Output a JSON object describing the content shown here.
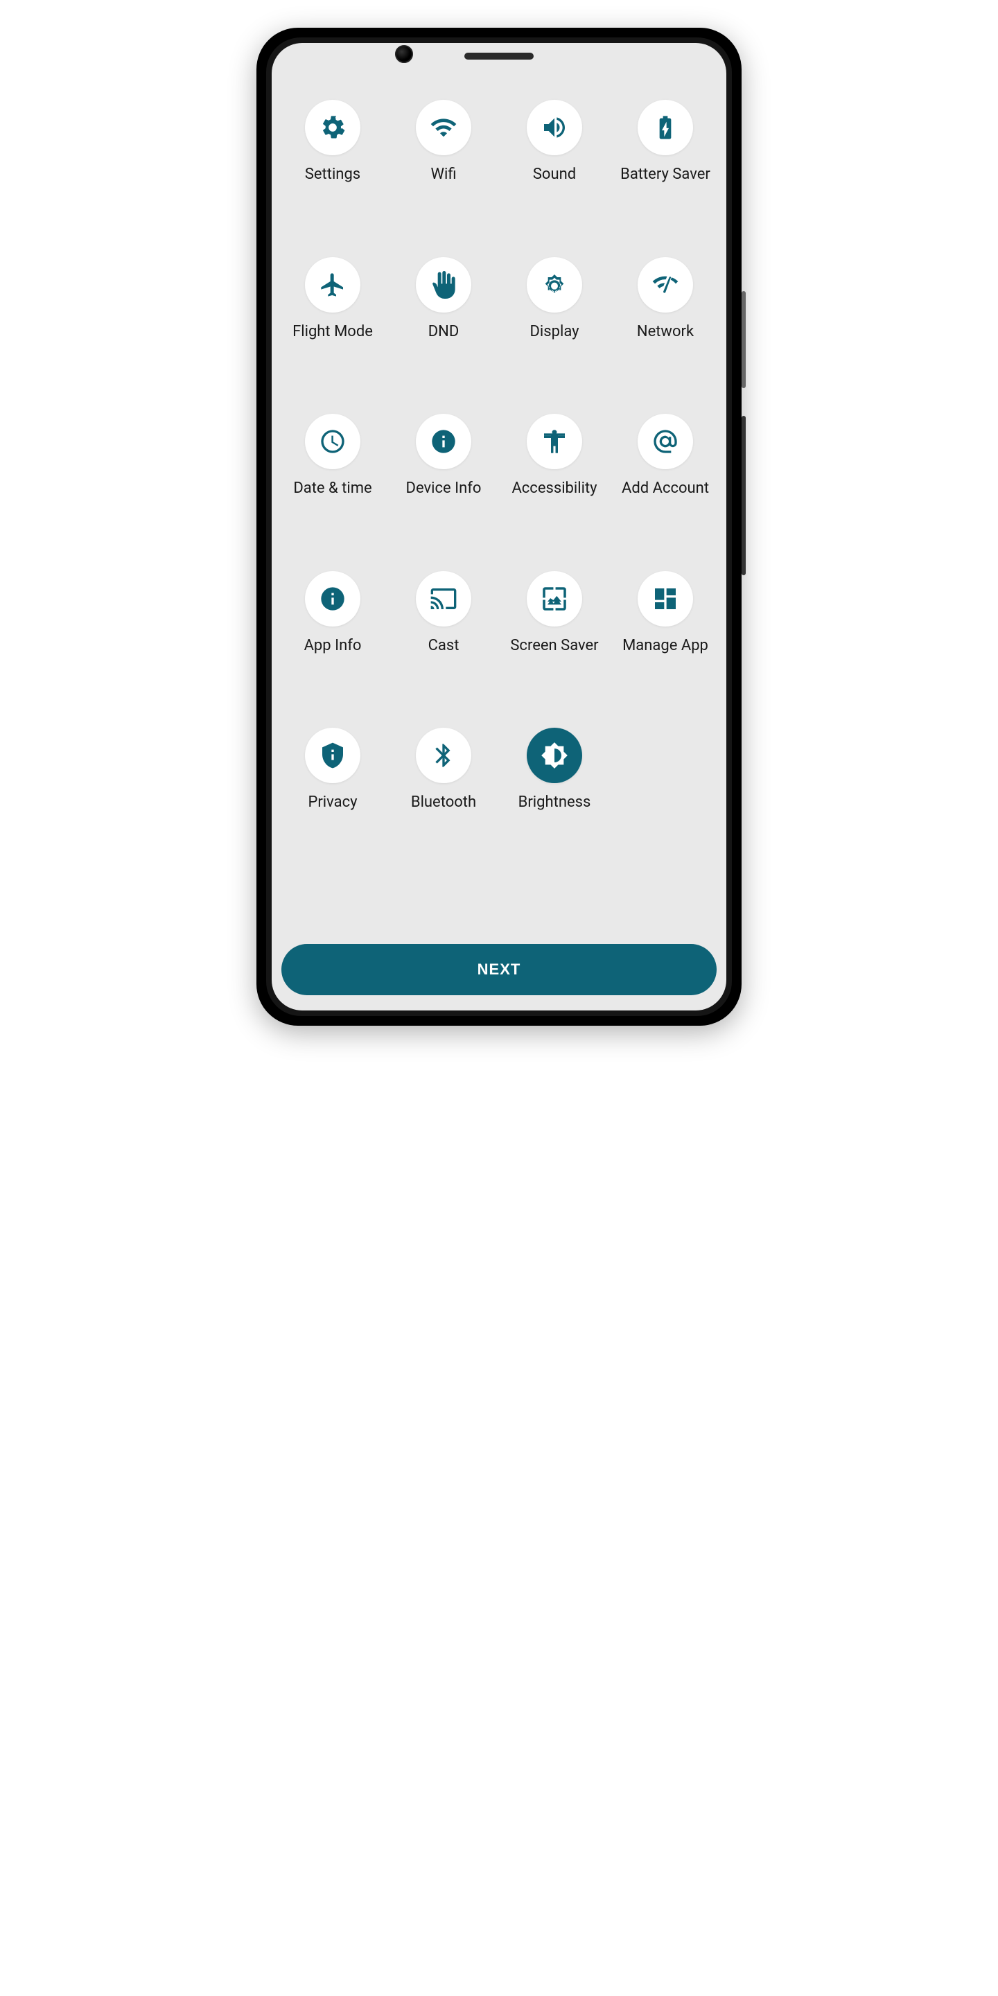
{
  "tiles": [
    {
      "id": "settings",
      "label": "Settings",
      "icon": "gear-icon",
      "active": false
    },
    {
      "id": "wifi",
      "label": "Wifi",
      "icon": "wifi-icon",
      "active": false
    },
    {
      "id": "sound",
      "label": "Sound",
      "icon": "sound-icon",
      "active": false
    },
    {
      "id": "battery-saver",
      "label": "Battery Saver",
      "icon": "battery-icon",
      "active": false
    },
    {
      "id": "flight-mode",
      "label": "Flight Mode",
      "icon": "airplane-icon",
      "active": false
    },
    {
      "id": "dnd",
      "label": "DND",
      "icon": "hand-icon",
      "active": false
    },
    {
      "id": "display",
      "label": "Display",
      "icon": "brightness-ring-icon",
      "active": false
    },
    {
      "id": "network",
      "label": "Network",
      "icon": "network-check-icon",
      "active": false
    },
    {
      "id": "date-time",
      "label": "Date & time",
      "icon": "clock-icon",
      "active": false
    },
    {
      "id": "device-info",
      "label": "Device Info",
      "icon": "info-icon",
      "active": false
    },
    {
      "id": "accessibility",
      "label": "Accessibility",
      "icon": "accessibility-icon",
      "active": false
    },
    {
      "id": "add-account",
      "label": "Add Account",
      "icon": "at-icon",
      "active": false
    },
    {
      "id": "app-info",
      "label": "App Info",
      "icon": "info-icon",
      "active": false
    },
    {
      "id": "cast",
      "label": "Cast",
      "icon": "cast-icon",
      "active": false
    },
    {
      "id": "screen-saver",
      "label": "Screen Saver",
      "icon": "wallpaper-icon",
      "active": false
    },
    {
      "id": "manage-app",
      "label": "Manage App",
      "icon": "dashboard-icon",
      "active": false
    },
    {
      "id": "privacy",
      "label": "Privacy",
      "icon": "privacy-icon",
      "active": false
    },
    {
      "id": "bluetooth",
      "label": "Bluetooth",
      "icon": "bluetooth-icon",
      "active": false
    },
    {
      "id": "brightness",
      "label": "Brightness",
      "icon": "brightness-half-icon",
      "active": true
    }
  ],
  "footer": {
    "next_label": "NEXT"
  },
  "colors": {
    "accent": "#0e6377",
    "screen_bg": "#e9e9e9"
  }
}
